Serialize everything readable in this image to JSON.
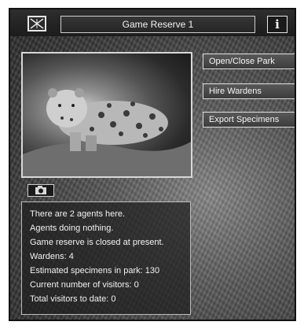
{
  "window": {
    "title": "Game Reserve 1",
    "info_label": "i"
  },
  "buttons": {
    "open_close": "Open/Close Park",
    "hire_wardens": "Hire Wardens",
    "export_specimens": "Export Specimens"
  },
  "status_lines": [
    "There are 2 agents here.",
    "Agents doing nothing.",
    "Game reserve is closed at present.",
    "Wardens: 4",
    "Estimated specimens in park: 130",
    "Current number of visitors: 0",
    "Total visitors to date: 0"
  ],
  "icons": {
    "close": "close-icon",
    "info": "info-icon",
    "camera": "camera-icon"
  }
}
